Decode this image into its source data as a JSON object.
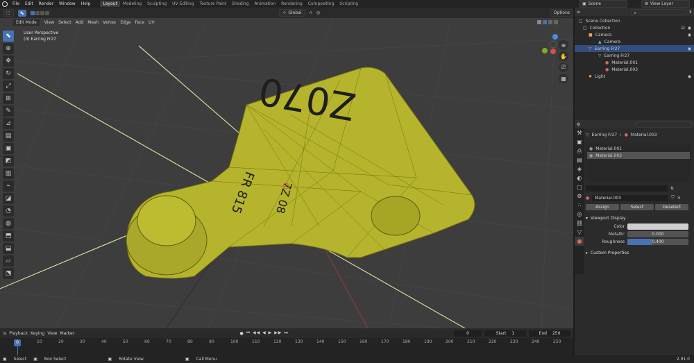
{
  "menu": [
    "File",
    "Edit",
    "Render",
    "Window",
    "Help"
  ],
  "workspaces": [
    "Layout",
    "Modeling",
    "Sculpting",
    "UV Editing",
    "Texture Paint",
    "Shading",
    "Animation",
    "Rendering",
    "Compositing",
    "Scripting"
  ],
  "scene": "Scene",
  "view_layer": "View Layer",
  "viewport": {
    "mode": "Edit Mode",
    "menus": [
      "View",
      "Select",
      "Add",
      "Mesh",
      "Vertex",
      "Edge",
      "Face",
      "UV"
    ],
    "orientation": "Global",
    "options": "Options",
    "overlay_title": "User Perspective",
    "overlay_sub": "(0) Earring Fr27",
    "tag_text_top": "Z070",
    "tag_text_mid": "FR 815",
    "tag_text_low": "7Z 08"
  },
  "outliner": {
    "items": [
      {
        "label": "Scene Collection"
      },
      {
        "label": "Collection"
      },
      {
        "label": "Camera"
      },
      {
        "label": "Camera"
      },
      {
        "label": "Earring Fr27"
      },
      {
        "label": "Earring Fr27"
      },
      {
        "label": "Material.001"
      },
      {
        "label": "Material.003"
      },
      {
        "label": "Light"
      }
    ]
  },
  "props": {
    "object": "Earring Fr27",
    "material": "Material.003",
    "slots": [
      "Material.001",
      "Material.003"
    ],
    "mat_field": "Material.003",
    "assign": "Assign",
    "select": "Select",
    "deselect": "Deselect",
    "section": "Viewport Display",
    "color_label": "Color",
    "metallic_label": "Metallic",
    "metallic": "0.000",
    "roughness_label": "Roughness",
    "roughness": "0.400",
    "roughness_frac": 0.4,
    "custom": "Custom Properties"
  },
  "timeline": {
    "menus": [
      "Playback",
      "Keying",
      "View",
      "Marker"
    ],
    "current": "0",
    "start_label": "Start",
    "start": "1",
    "end_label": "End",
    "end": "250",
    "ticks": [
      "0",
      "10",
      "20",
      "30",
      "40",
      "50",
      "60",
      "70",
      "80",
      "90",
      "100",
      "110",
      "120",
      "130",
      "140",
      "150",
      "160",
      "170",
      "180",
      "190",
      "200",
      "210",
      "220",
      "230",
      "240",
      "250"
    ],
    "cursor": "0"
  },
  "status": {
    "select": "Select",
    "box": "Box Select",
    "rotate": "Rotate View",
    "menu": "Call Menu",
    "version": "2.91.0"
  },
  "colors": {
    "accent": "#4772b3",
    "mesh": "#b5b42c",
    "outliner_sel": "#334d80"
  }
}
